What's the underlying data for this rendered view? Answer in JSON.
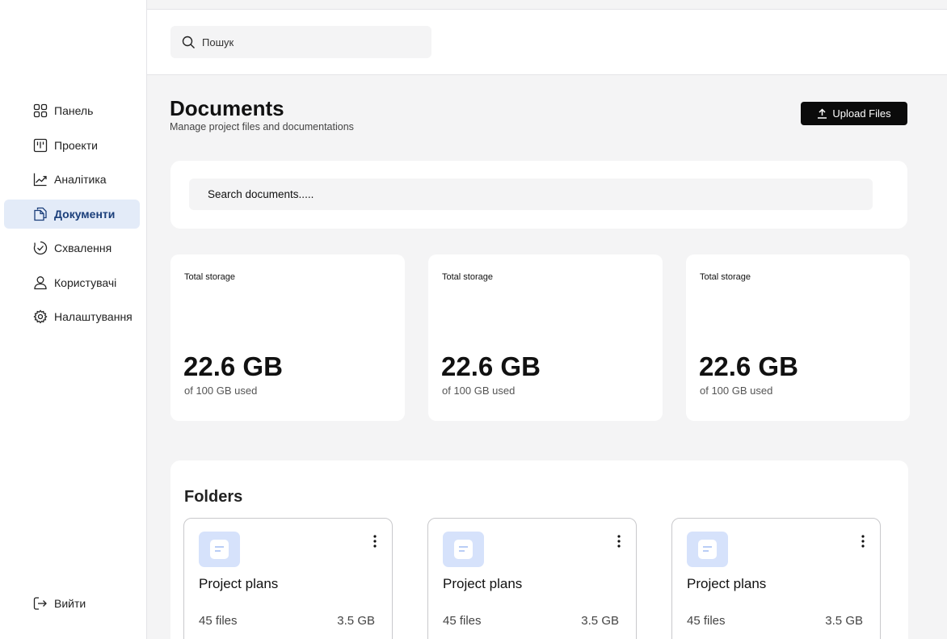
{
  "sidebar": {
    "items": [
      {
        "label": "Панель",
        "icon": "dashboard-icon",
        "active": false
      },
      {
        "label": "Проекти",
        "icon": "kanban-icon",
        "active": false
      },
      {
        "label": "Аналітика",
        "icon": "chart-line-icon",
        "active": false
      },
      {
        "label": "Документи",
        "icon": "documents-icon",
        "active": true
      },
      {
        "label": "Схвалення",
        "icon": "approval-icon",
        "active": false
      },
      {
        "label": "Користувачі",
        "icon": "user-icon",
        "active": false
      },
      {
        "label": "Налаштування",
        "icon": "gear-icon",
        "active": false
      }
    ],
    "logout_label": "Вийти"
  },
  "topbar": {
    "search_placeholder": "Пошук"
  },
  "header": {
    "title": "Documents",
    "subtitle": "Manage project files and documentations",
    "upload_label": "Upload Files"
  },
  "doc_search": {
    "placeholder": "Search documents....."
  },
  "stats": [
    {
      "label": "Total storage",
      "value": "22.6 GB",
      "sub": "of 100 GB used"
    },
    {
      "label": "Total storage",
      "value": "22.6 GB",
      "sub": "of 100 GB used"
    },
    {
      "label": "Total storage",
      "value": "22.6 GB",
      "sub": "of 100 GB used"
    }
  ],
  "folders": {
    "title": "Folders",
    "items": [
      {
        "name": "Project plans",
        "files": "45 files",
        "size": "3.5 GB"
      },
      {
        "name": "Project plans",
        "files": "45 files",
        "size": "3.5 GB"
      },
      {
        "name": "Project plans",
        "files": "45 files",
        "size": "3.5 GB"
      }
    ]
  },
  "colors": {
    "active_nav_bg": "#e3ebf8",
    "active_nav_text": "#1a3e7a",
    "folder_icon_bg": "#d6e2fb",
    "button_bg": "#0b0b0b"
  }
}
